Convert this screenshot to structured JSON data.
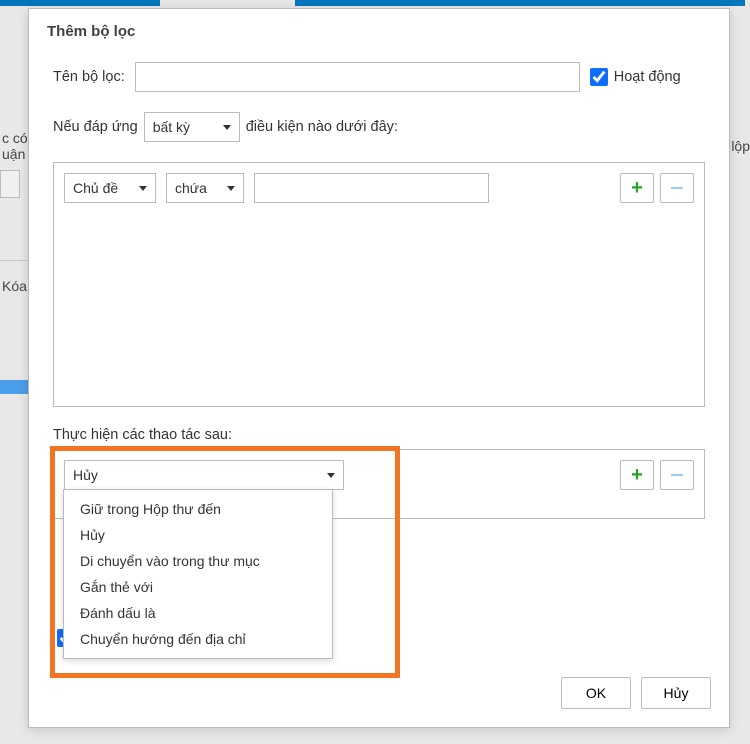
{
  "dialog": {
    "title": "Thêm bộ lọc",
    "filter_name_label": "Tên bộ lọc:",
    "filter_name_value": "",
    "active_label": "Hoạt động",
    "active_checked": true,
    "conditions_label_pre": "Nếu đáp ứng",
    "match_mode": "bất kỳ",
    "conditions_label_post": "điều kiện nào dưới đây:",
    "condition": {
      "field": "Chủ đề",
      "operator": "chứa",
      "value": ""
    },
    "actions_label": "Thực hiện các thao tác sau:",
    "action": {
      "selected": "Hủy",
      "options": [
        "Giữ trong Hộp thư đến",
        "Hủy",
        "Di chuyển vào trong thư mục",
        "Gắn thẻ với",
        "Đánh dấu là",
        "Chuyển hướng đến địa chỉ"
      ]
    },
    "ok_label": "OK",
    "cancel_label": "Hủy"
  },
  "bg": {
    "left1": "c có",
    "left2": "uận",
    "right1": "lộp",
    "koa": "Kóa"
  }
}
